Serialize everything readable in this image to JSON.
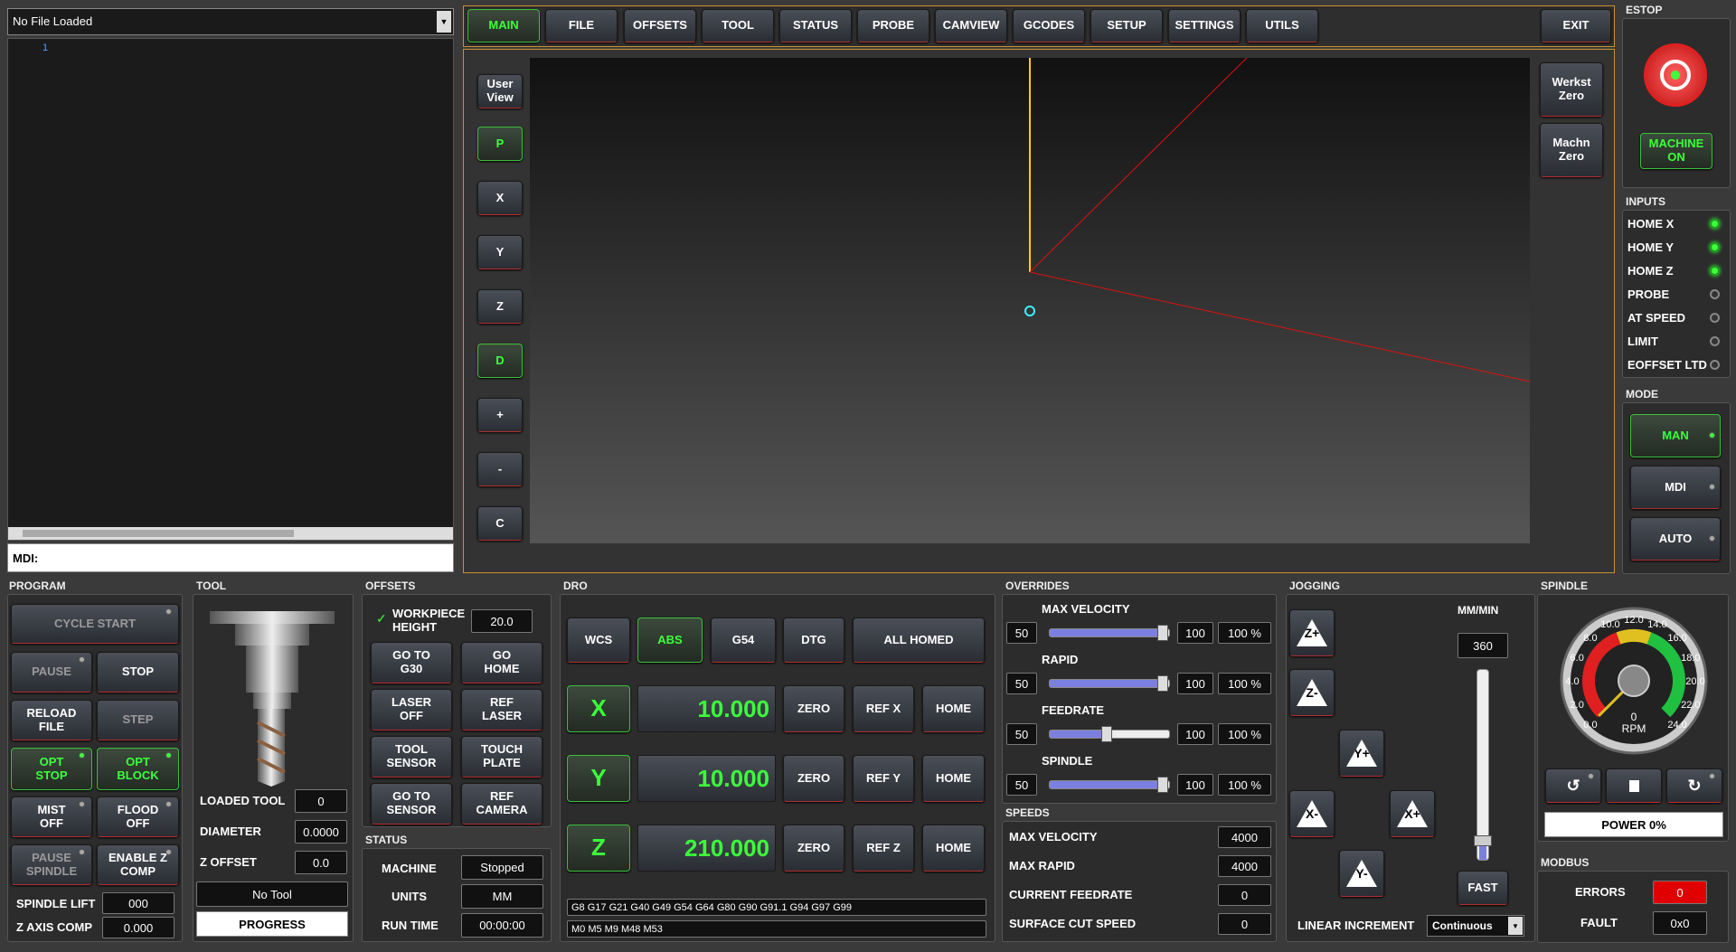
{
  "file": {
    "name": "No File Loaded",
    "line_num": "1",
    "mdi_label": "MDI:"
  },
  "tabs": [
    "MAIN",
    "FILE",
    "OFFSETS",
    "TOOL",
    "STATUS",
    "PROBE",
    "CAMVIEW",
    "GCODES",
    "SETUP",
    "SETTINGS",
    "UTILS"
  ],
  "exit": "EXIT",
  "view_buttons": [
    "User View",
    "P",
    "X",
    "Y",
    "Z",
    "D",
    "+",
    "-",
    "C"
  ],
  "zero_buttons": [
    "Werkst Zero",
    "Machn Zero"
  ],
  "estop": {
    "title": "ESTOP",
    "machine": "MACHINE ON"
  },
  "inputs": {
    "title": "INPUTS",
    "items": [
      {
        "label": "HOME X",
        "on": true
      },
      {
        "label": "HOME Y",
        "on": true
      },
      {
        "label": "HOME Z",
        "on": true
      },
      {
        "label": "PROBE",
        "on": false
      },
      {
        "label": "AT SPEED",
        "on": false
      },
      {
        "label": "LIMIT",
        "on": false
      },
      {
        "label": "EOFFSET LTD",
        "on": false
      }
    ]
  },
  "mode": {
    "title": "MODE",
    "items": [
      "MAN",
      "MDI",
      "AUTO"
    ]
  },
  "program": {
    "title": "PROGRAM",
    "cycle_start": "CYCLE START",
    "pause": "PAUSE",
    "stop": "STOP",
    "reload": "RELOAD FILE",
    "step": "STEP",
    "opt_stop": "OPT STOP",
    "opt_block": "OPT BLOCK",
    "mist": "MIST OFF",
    "flood": "FLOOD OFF",
    "pause_spindle": "PAUSE SPINDLE",
    "enable_zcomp": "ENABLE Z COMP",
    "spindle_lift_label": "SPINDLE LIFT",
    "spindle_lift": "000",
    "zaxis_label": "Z AXIS COMP",
    "zaxis": "0.000"
  },
  "tool": {
    "title": "TOOL",
    "loaded_label": "LOADED TOOL",
    "loaded": "0",
    "diameter_label": "DIAMETER",
    "diameter": "0.0000",
    "zoffset_label": "Z OFFSET",
    "zoffset": "0.0",
    "name": "No Tool",
    "progress": "PROGRESS"
  },
  "offsets": {
    "title": "OFFSETS",
    "wp_label": "WORKPIECE HEIGHT",
    "wp_value": "20.0",
    "btns": [
      "GO TO G30",
      "GO HOME",
      "LASER OFF",
      "REF LASER",
      "TOOL SENSOR",
      "TOUCH PLATE",
      "GO TO SENSOR",
      "REF CAMERA"
    ]
  },
  "status": {
    "title": "STATUS",
    "machine_label": "MACHINE",
    "machine": "Stopped",
    "units_label": "UNITS",
    "units": "MM",
    "runtime_label": "RUN TIME",
    "runtime": "00:00:00"
  },
  "dro": {
    "title": "DRO",
    "wcs": "WCS",
    "abs": "ABS",
    "g54": "G54",
    "dtg": "DTG",
    "homed": "ALL HOMED",
    "axes": [
      {
        "name": "X",
        "value": "10.000",
        "ref": "REF X"
      },
      {
        "name": "Y",
        "value": "10.000",
        "ref": "REF Y"
      },
      {
        "name": "Z",
        "value": "210.000",
        "ref": "REF Z"
      }
    ],
    "zero": "ZERO",
    "home": "HOME",
    "gcodes": "G8 G17 G21 G40 G49 G54 G64 G80 G90 G91.1 G94 G97 G99",
    "mcodes": "M0 M5 M9 M48 M53"
  },
  "overrides": {
    "title": "OVERRIDES",
    "items": [
      {
        "label": "MAX VELOCITY",
        "min": "50",
        "max": "100",
        "pct": "100 %",
        "level": 1.0
      },
      {
        "label": "RAPID",
        "min": "50",
        "max": "100",
        "pct": "100 %",
        "level": 1.0
      },
      {
        "label": "FEEDRATE",
        "min": "50",
        "max": "100",
        "pct": "100 %",
        "level": 0.5
      },
      {
        "label": "SPINDLE",
        "min": "50",
        "max": "100",
        "pct": "100 %",
        "level": 1.0
      }
    ]
  },
  "speeds": {
    "title": "SPEEDS",
    "items": [
      {
        "label": "MAX VELOCITY",
        "value": "4000"
      },
      {
        "label": "MAX RAPID",
        "value": "4000"
      },
      {
        "label": "CURRENT FEEDRATE",
        "value": "0"
      },
      {
        "label": "SURFACE CUT SPEED",
        "value": "0"
      }
    ]
  },
  "jogging": {
    "title": "JOGGING",
    "units": "MM/MIN",
    "rate": "360",
    "fast": "FAST",
    "inc_label": "LINEAR INCREMENT",
    "inc": "Continuous",
    "keys": [
      "Z+",
      "Z-",
      "Y+",
      "X-",
      "X+",
      "Y-"
    ]
  },
  "spindle": {
    "title": "SPINDLE",
    "ticks": [
      "0.0",
      "2.0",
      "4.0",
      "6.0",
      "8.0",
      "10.0",
      "12.0",
      "14.0",
      "16.0",
      "18.0",
      "20.0",
      "22.0",
      "24.0"
    ],
    "rpm_value": "0",
    "rpm_label": "RPM",
    "power": "POWER 0%"
  },
  "modbus": {
    "title": "MODBUS",
    "errors_label": "ERRORS",
    "errors": "0",
    "fault_label": "FAULT",
    "fault": "0x0"
  }
}
